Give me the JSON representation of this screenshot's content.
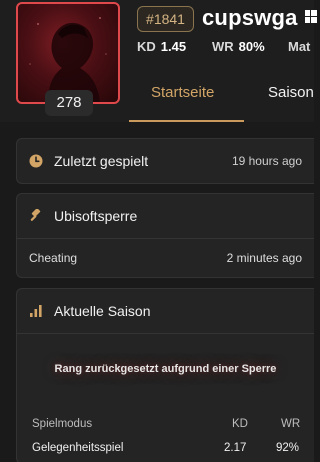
{
  "profile": {
    "level": "278",
    "rank_tag": "#1841",
    "username": "cupswga",
    "stats": [
      {
        "label": "KD",
        "value": "1.45"
      },
      {
        "label": "WR",
        "value": "80%"
      },
      {
        "label": "Mat",
        "value": ""
      }
    ]
  },
  "tabs": [
    {
      "label": "Startseite",
      "active": true
    },
    {
      "label": "Saison",
      "active": false
    }
  ],
  "last_played": {
    "title": "Zuletzt gespielt",
    "time": "19 hours ago",
    "icon": "clock-icon"
  },
  "ban": {
    "title": "Ubisoftsperre",
    "icon": "gavel-icon",
    "reason": "Cheating",
    "time": "2 minutes ago"
  },
  "season": {
    "title": "Aktuelle Saison",
    "icon": "bar-chart-icon",
    "reset_notice": "Rang zurückgesetzt aufgrund einer Sperre",
    "table": {
      "headers": [
        "Spielmodus",
        "KD",
        "WR"
      ],
      "rows": [
        [
          "Gelegenheitsspiel",
          "2.17",
          "92%"
        ]
      ]
    }
  },
  "colors": {
    "accent": "#c99a5b",
    "avatar_border": "#e0494c",
    "background": "#1a1a1a",
    "card": "#242424"
  }
}
